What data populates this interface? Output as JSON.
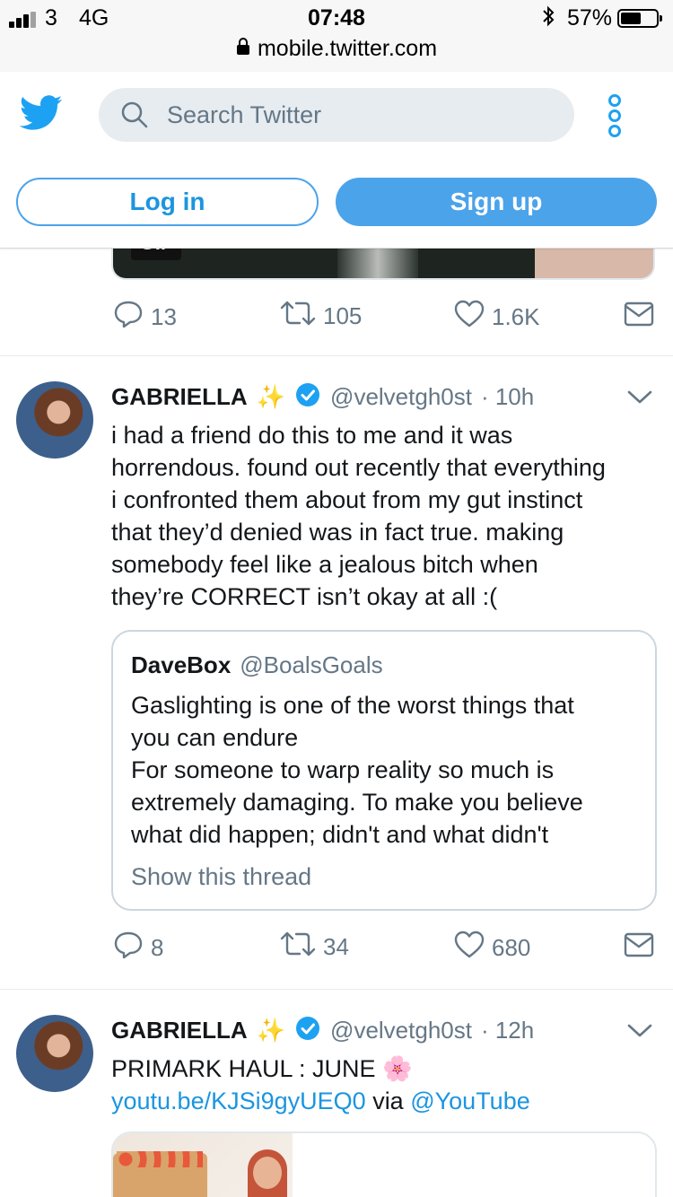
{
  "status_bar": {
    "carrier": "3",
    "network": "4G",
    "time": "07:48",
    "url": "mobile.twitter.com",
    "battery": "57%",
    "battery_level": 0.57
  },
  "header": {
    "search_placeholder": "Search Twitter",
    "login_label": "Log in",
    "signup_label": "Sign up"
  },
  "colors": {
    "accent": "#1da1f2",
    "signup_bg": "#4ba3ea",
    "muted": "#657786",
    "verified": "#1da1f2"
  },
  "prev_tweet": {
    "media_caption": "GIF",
    "replies": "13",
    "retweets": "105",
    "likes": "1.6K"
  },
  "tweet1": {
    "name": "GABRIELLA",
    "emoji": "✨",
    "handle": "@velvetgh0st",
    "time": "· 10h",
    "text_lines": [
      "i had a friend do this to me and it was",
      "horrendous. found out recently that everything",
      "i confronted them about from my gut instinct",
      "that they’d denied was in fact true. making",
      "somebody feel like a jealous bitch when",
      "they’re CORRECT isn’t okay at all :("
    ],
    "quote": {
      "name": "DaveBox",
      "handle": "@BoalsGoals",
      "text_lines": [
        "Gaslighting is one of the worst things that",
        "you can endure",
        "For someone to warp reality so much is",
        "extremely damaging. To make you believe",
        "what did happen; didn't and what didn't"
      ],
      "show_thread": "Show this thread"
    },
    "replies": "8",
    "retweets": "34",
    "likes": "680"
  },
  "tweet2": {
    "name": "GABRIELLA",
    "emoji": "✨",
    "handle": "@velvetgh0st",
    "time": "· 12h",
    "text": "PRIMARK HAUL : JUNE",
    "text_emoji": "🌸",
    "link": "youtu.be/KJSi9gyUEQ0",
    "via": "via",
    "via_mention": "@YouTube"
  }
}
